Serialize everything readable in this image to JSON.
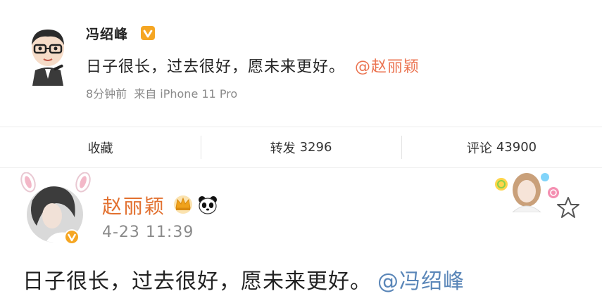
{
  "post1": {
    "author": "冯绍峰",
    "text": "日子很长，过去很好，愿未来更好。",
    "mention": "@赵丽颖",
    "time": "8分钟前",
    "source": "来自 iPhone 11 Pro"
  },
  "actions": {
    "favorite_label": "收藏",
    "repost_label": "转发",
    "repost_count": "3296",
    "comment_label": "评论",
    "comment_count": "43900"
  },
  "post2": {
    "author": "赵丽颖",
    "time": "4-23 11:39",
    "text": "日子很长，过去很好，愿未来更好。",
    "mention": "@冯绍峰"
  },
  "colors": {
    "mention_orange": "#eb7350",
    "author_orange": "#e2702f",
    "mention_blue": "#5a86b8",
    "badge_orange": "#f5a623"
  },
  "icons": [
    "verified-badge-icon",
    "crown-icon",
    "panda-icon",
    "star-icon"
  ]
}
